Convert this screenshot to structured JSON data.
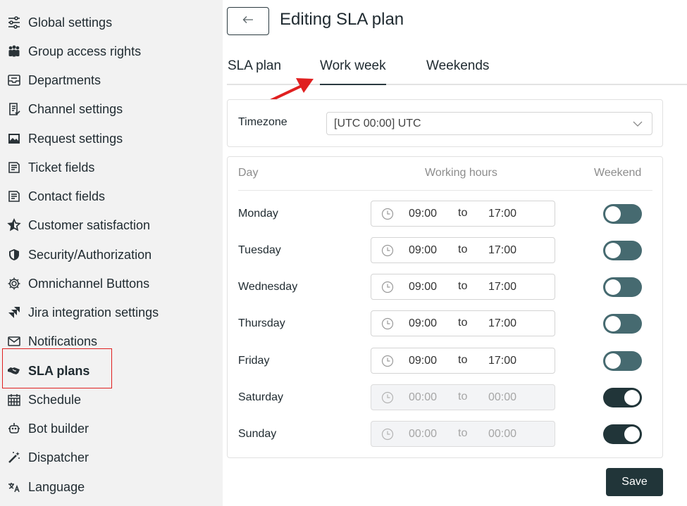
{
  "sidebar": {
    "items": [
      {
        "label": "Global settings",
        "icon": "sliders-icon"
      },
      {
        "label": "Group access rights",
        "icon": "group-icon"
      },
      {
        "label": "Departments",
        "icon": "inbox-icon"
      },
      {
        "label": "Channel settings",
        "icon": "checklist-icon"
      },
      {
        "label": "Request settings",
        "icon": "image-card-icon"
      },
      {
        "label": "Ticket fields",
        "icon": "list-doc-icon"
      },
      {
        "label": "Contact fields",
        "icon": "list-doc-icon"
      },
      {
        "label": "Customer satisfaction",
        "icon": "star-icon"
      },
      {
        "label": "Security/Authorization",
        "icon": "shield-icon"
      },
      {
        "label": "Omnichannel Buttons",
        "icon": "gear-icon"
      },
      {
        "label": "Jira integration settings",
        "icon": "jira-icon"
      },
      {
        "label": "Notifications",
        "icon": "envelope-icon"
      },
      {
        "label": "SLA plans",
        "icon": "handshake-icon",
        "active": true
      },
      {
        "label": "Schedule",
        "icon": "calendar-icon"
      },
      {
        "label": "Bot builder",
        "icon": "robot-icon"
      },
      {
        "label": "Dispatcher",
        "icon": "magic-wand-icon"
      },
      {
        "label": "Language",
        "icon": "language-icon"
      }
    ]
  },
  "header": {
    "back_icon": "arrow-left-icon",
    "title": "Editing SLA plan"
  },
  "tabs": [
    {
      "label": "SLA plan",
      "active": false
    },
    {
      "label": "Work week",
      "active": true
    },
    {
      "label": "Weekends",
      "active": false
    }
  ],
  "timezone": {
    "label": "Timezone",
    "value": "[UTC 00:00] UTC"
  },
  "schedule": {
    "headers": {
      "day": "Day",
      "hours": "Working hours",
      "weekend": "Weekend"
    },
    "separator": "to",
    "days": [
      {
        "day": "Monday",
        "from": "09:00",
        "to": "17:00",
        "weekend": false
      },
      {
        "day": "Tuesday",
        "from": "09:00",
        "to": "17:00",
        "weekend": false
      },
      {
        "day": "Wednesday",
        "from": "09:00",
        "to": "17:00",
        "weekend": false
      },
      {
        "day": "Thursday",
        "from": "09:00",
        "to": "17:00",
        "weekend": false
      },
      {
        "day": "Friday",
        "from": "09:00",
        "to": "17:00",
        "weekend": false
      },
      {
        "day": "Saturday",
        "from": "00:00",
        "to": "00:00",
        "weekend": true
      },
      {
        "day": "Sunday",
        "from": "00:00",
        "to": "00:00",
        "weekend": true
      }
    ]
  },
  "actions": {
    "save_label": "Save"
  },
  "colors": {
    "accent_dark": "#213539",
    "toggle_off": "#466a70",
    "annotation_red": "#e02020",
    "sidebar_bg": "#f2f2f2"
  }
}
